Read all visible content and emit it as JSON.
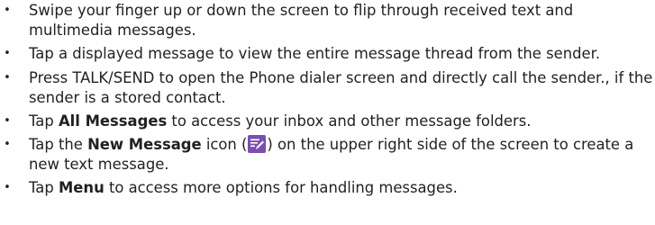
{
  "bullet_glyph": "•",
  "items": [
    {
      "text": "Swipe your finger up or down the screen to flip through received text and multimedia messages."
    },
    {
      "text": "Tap a displayed message to view the entire message thread from the sender."
    },
    {
      "text": "Press TALK/SEND to open the Phone dialer screen and directly call the sender., if the sender is a stored contact."
    },
    {
      "pre": "Tap ",
      "bold": "All Messages",
      "post": " to access your inbox and other message folders."
    },
    {
      "pre": "Tap the ",
      "bold": "New Message",
      "mid": " icon (",
      "icon": "new-message-icon",
      "post": ") on the upper right side of the screen to create a new text message."
    },
    {
      "pre": "Tap ",
      "bold": "Menu",
      "post": " to access more options for handling messages."
    }
  ],
  "colors": {
    "text": "#231f20",
    "icon_bg": "#7a4fb0",
    "icon_fg": "#ffffff"
  }
}
